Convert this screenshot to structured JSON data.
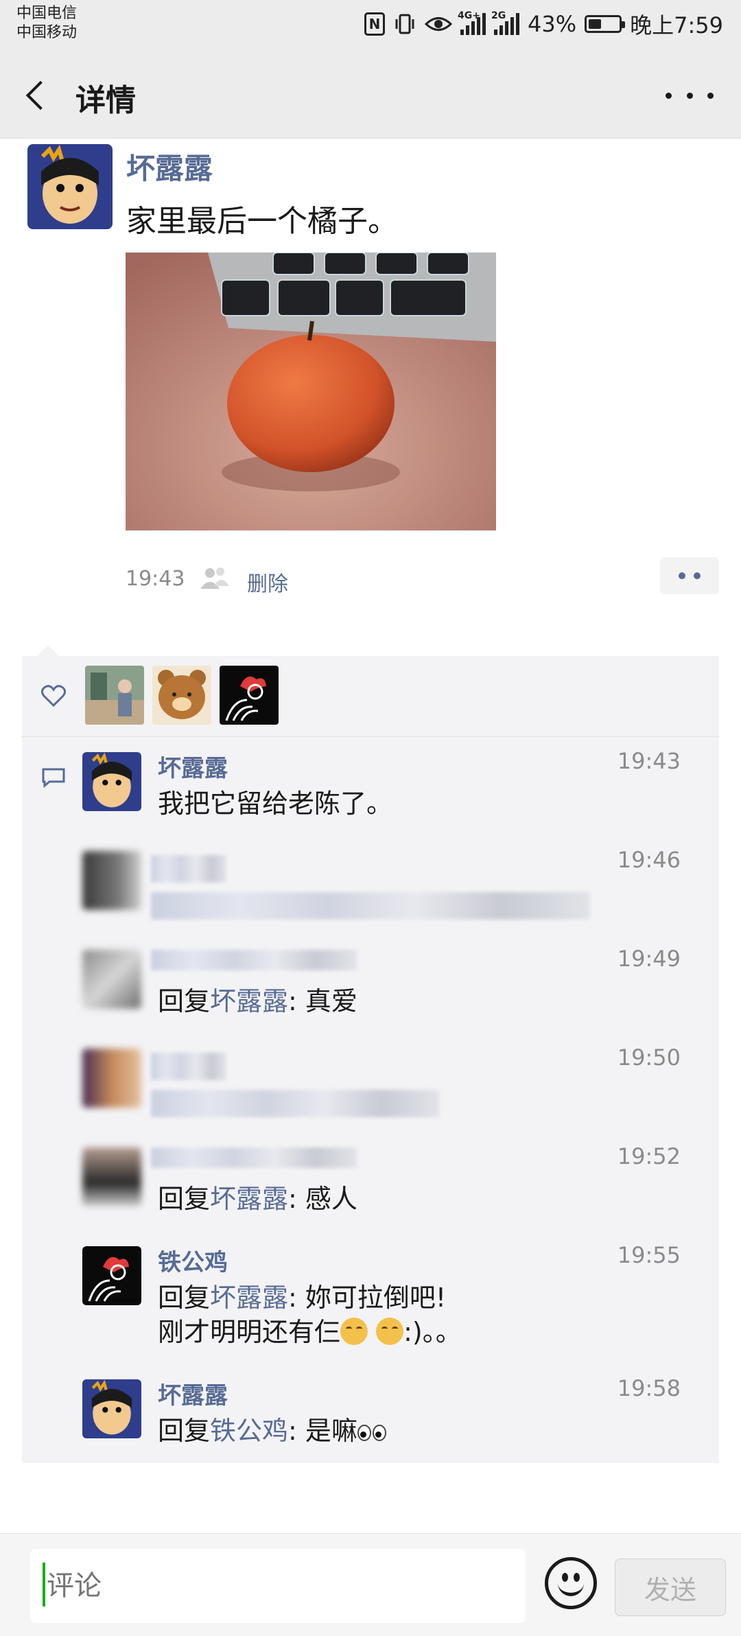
{
  "status_bar": {
    "carrier_1": "中国电信",
    "carrier_2": "中国移动",
    "network_1": "4G+",
    "network_2": "2G",
    "battery": "43%",
    "battery_level": 0.43,
    "time": "晚上7:59"
  },
  "header": {
    "title": "详情"
  },
  "post": {
    "author": "坏露露",
    "text": "家里最后一个橘子。",
    "time": "19:43",
    "delete_label": "删除"
  },
  "likes": {
    "icon": "heart-icon",
    "avatars": [
      "liker-photo-person",
      "liker-photo-rilakkuma",
      "liker-photo-rooster"
    ]
  },
  "comments": [
    {
      "name": "坏露露",
      "time": "19:43",
      "text": "我把它留给老陈了。"
    },
    {
      "name": "",
      "time": "19:46",
      "text": ""
    },
    {
      "name": "",
      "time": "19:49",
      "reply_prefix": "回复",
      "reply_to": "坏露露",
      "text": ": 真爱"
    },
    {
      "name": "",
      "time": "19:50",
      "text": ""
    },
    {
      "name": "",
      "time": "19:52",
      "reply_prefix": "回复",
      "reply_to": "坏露露",
      "text": ": 感人"
    },
    {
      "name": "铁公鸡",
      "time": "19:55",
      "reply_prefix": "回复",
      "reply_to": "坏露露",
      "text": ": 妳可拉倒吧!",
      "text_line2": "刚才明明还有仨",
      "text_line2_tail": ":)。。"
    },
    {
      "name": "坏露露",
      "time": "19:58",
      "reply_prefix": "回复",
      "reply_to": "铁公鸡",
      "text": ": 是嘛"
    }
  ],
  "input": {
    "placeholder": "评论",
    "send_label": "发送"
  }
}
